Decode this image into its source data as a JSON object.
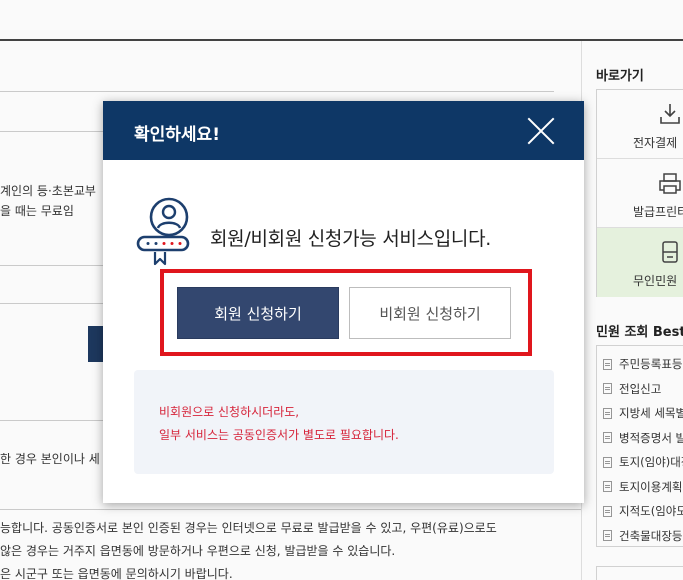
{
  "background": {
    "left_snippets": [
      "계인의 등·초본교부",
      "을 때는 무료임",
      "한 경우 본인이나 세"
    ],
    "bottom_lines": [
      "능합니다. 공동인증서로 본인 인증된 경우는 인터넷으로 무료로 발급받을 수 있고, 우편(유료)으로도",
      "않은 경우는 거주지 읍면동에 방문하거나 우편으로 신청, 발급받을 수 있습니다.",
      "은 시군구 또는 읍면동에 문의하시기 바랍니다."
    ]
  },
  "sidebar": {
    "quick_title": "바로가기",
    "quick_items": [
      {
        "label": "전자결제",
        "icon": "download-icon"
      },
      {
        "label": "발급프린터",
        "icon": "printer-icon"
      },
      {
        "label": "무인민원",
        "icon": "kiosk-icon"
      }
    ],
    "best_title": "민원 조회 Best",
    "best_items": [
      "주민등록표등",
      "전입신고",
      "지방세 세목별",
      "병적증명서 발",
      "토지(임야)대장",
      "토지이용계획",
      "지적도(임야도",
      "건축물대장등"
    ]
  },
  "modal": {
    "title": "확인하세요!",
    "message": "회원/비회원 신청가능 서비스입니다.",
    "member_button": "회원 신청하기",
    "guest_button": "비회원 신청하기",
    "notice_line1": "비회원으로 신청하시더라도,",
    "notice_line2": "일부 서비스는 공동인증서가 별도로 필요합니다."
  },
  "colors": {
    "header": "#0e3766",
    "member_button": "#33476f",
    "highlight_border": "#e0161d",
    "notice_text": "#d6243a",
    "kiosk_bg": "#eaf6e2"
  }
}
